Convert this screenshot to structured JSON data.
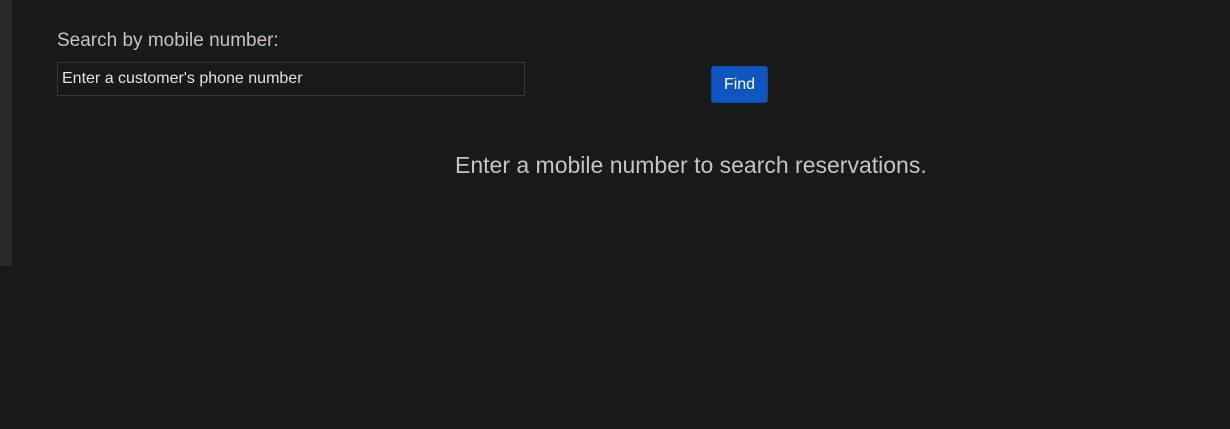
{
  "search": {
    "label": "Search by mobile number:",
    "value": "",
    "placeholder": "Enter a customer's phone number",
    "button_label": "Find"
  },
  "results": {
    "empty_message": "Enter a mobile number to search reservations."
  },
  "colors": {
    "background": "#181a1a",
    "accent": "#0f55bf",
    "text": "#c8c4bd"
  }
}
